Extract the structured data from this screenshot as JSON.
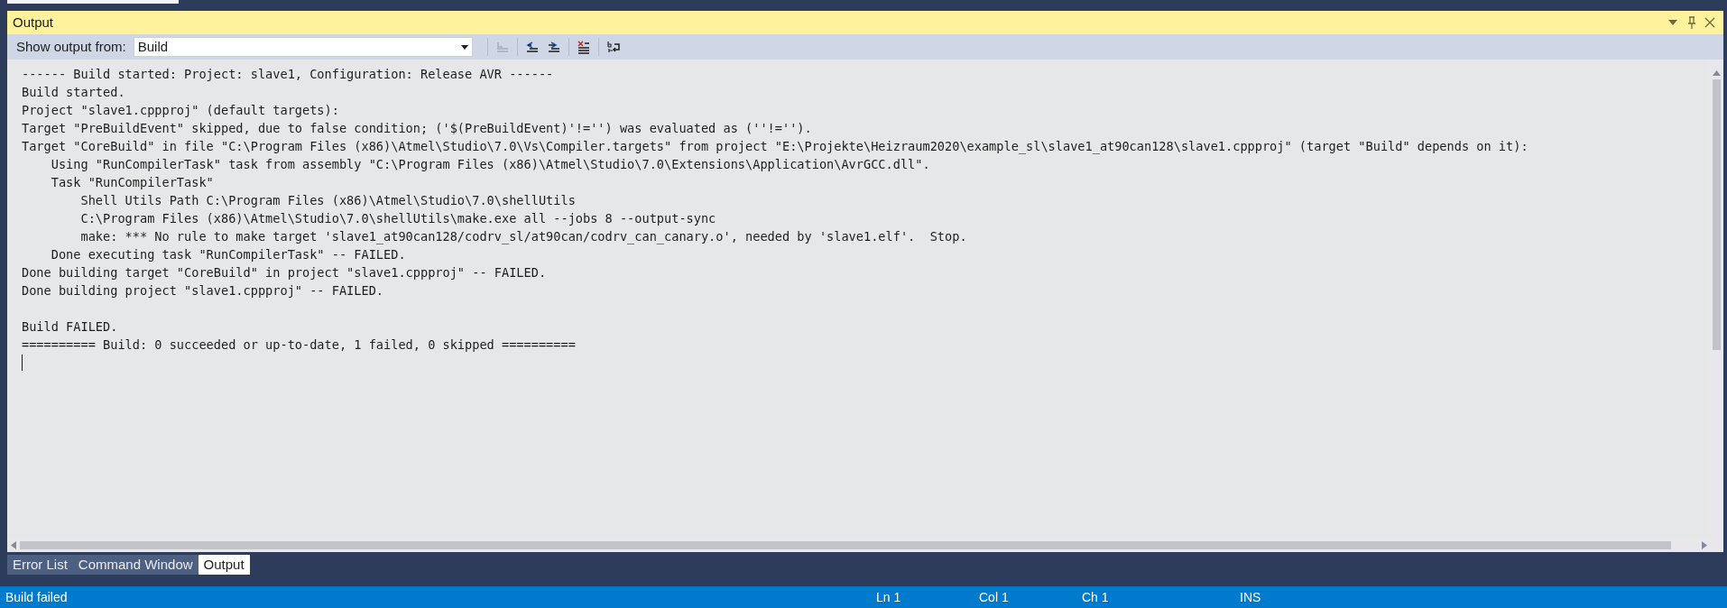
{
  "panel": {
    "title": "Output"
  },
  "toolbar": {
    "label": "Show output from:",
    "source": "Build",
    "buttons": [
      {
        "kind": "goto-current",
        "disabled": true
      },
      {
        "kind": "previous",
        "disabled": false
      },
      {
        "kind": "next",
        "disabled": false
      },
      {
        "kind": "clear",
        "disabled": false
      },
      {
        "kind": "word-wrap",
        "disabled": false
      }
    ]
  },
  "lines": [
    {
      "kind": "text",
      "text": "------ Build started: Project: slave1, Configuration: Release AVR ------"
    },
    {
      "kind": "text",
      "text": "Build started."
    },
    {
      "kind": "text",
      "text": "Project \"slave1.cppproj\" (default targets):"
    },
    {
      "kind": "text",
      "text": "Target \"PreBuildEvent\" skipped, due to false condition; ('$(PreBuildEvent)'!='') was evaluated as (''!='')."
    },
    {
      "kind": "text",
      "text": "Target \"CoreBuild\" in file \"C:\\Program Files (x86)\\Atmel\\Studio\\7.0\\Vs\\Compiler.targets\" from project \"E:\\Projekte\\Heizraum2020\\example_sl\\slave1_at90can128\\slave1.cppproj\" (target \"Build\" depends on it):"
    },
    {
      "kind": "text",
      "text": "    Using \"RunCompilerTask\" task from assembly \"C:\\Program Files (x86)\\Atmel\\Studio\\7.0\\Extensions\\Application\\AvrGCC.dll\"."
    },
    {
      "kind": "text",
      "text": "    Task \"RunCompilerTask\""
    },
    {
      "kind": "text",
      "text": "        Shell Utils Path C:\\Program Files (x86)\\Atmel\\Studio\\7.0\\shellUtils"
    },
    {
      "kind": "text",
      "text": "        C:\\Program Files (x86)\\Atmel\\Studio\\7.0\\shellUtils\\make.exe all --jobs 8 --output-sync"
    },
    {
      "kind": "text",
      "text": "        make: *** No rule to make target 'slave1_at90can128/codrv_sl/at90can/codrv_can_canary.o', needed by 'slave1.elf'.  Stop."
    },
    {
      "kind": "text",
      "text": "    Done executing task \"RunCompilerTask\" -- FAILED."
    },
    {
      "kind": "text",
      "text": "Done building target \"CoreBuild\" in project \"slave1.cppproj\" -- FAILED."
    },
    {
      "kind": "text",
      "text": "Done building project \"slave1.cppproj\" -- FAILED."
    },
    {
      "kind": "blank"
    },
    {
      "kind": "text",
      "text": "Build FAILED."
    },
    {
      "kind": "text",
      "text": "========== Build: 0 succeeded or up-to-date, 1 failed, 0 skipped =========="
    }
  ],
  "tabs": [
    {
      "label": "Error List",
      "selected": false
    },
    {
      "label": "Command Window",
      "selected": false
    },
    {
      "label": "Output",
      "selected": true
    }
  ],
  "status_bar": {
    "message": "Build failed",
    "line": "Ln 1",
    "column": "Col 1",
    "char": "Ch 1",
    "mode": "INS"
  }
}
